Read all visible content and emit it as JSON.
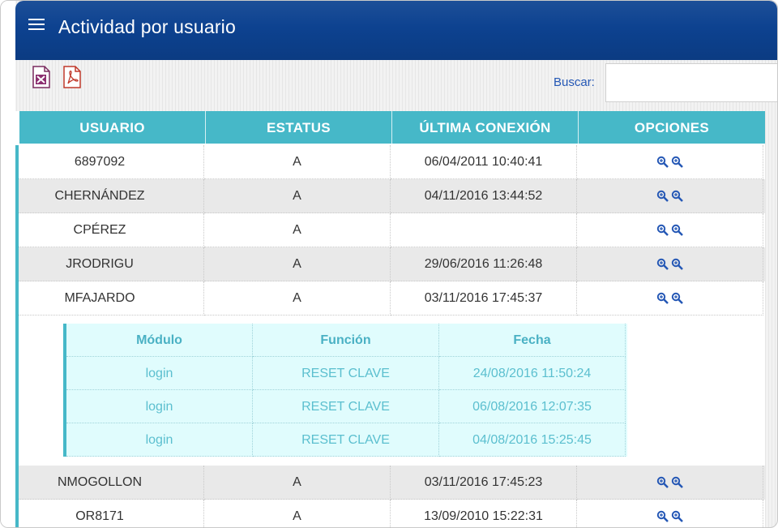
{
  "header": {
    "title": "Actividad por usuario"
  },
  "toolbar": {
    "export_excel_icon": "excel-icon",
    "export_pdf_icon": "pdf-icon",
    "search_label": "Buscar:",
    "search_value": ""
  },
  "colors": {
    "header": "#0d4290",
    "table_header": "#46b8c8",
    "detail_bg": "#e0fcfd",
    "detail_text": "#5bbfcf",
    "icon_blue": "#2457b5"
  },
  "table": {
    "columns": [
      "USUARIO",
      "ESTATUS",
      "ÚLTIMA CONEXIÓN",
      "OPCIONES"
    ],
    "rows": [
      {
        "usuario": "6897092",
        "estatus": "A",
        "conexion": "06/04/2011 10:40:41"
      },
      {
        "usuario": "CHERNÁNDEZ",
        "estatus": "A",
        "conexion": "04/11/2016 13:44:52"
      },
      {
        "usuario": "CPÉREZ",
        "estatus": "A",
        "conexion": ""
      },
      {
        "usuario": "JRODRIGU",
        "estatus": "A",
        "conexion": "29/06/2016 11:26:48"
      },
      {
        "usuario": "MFAJARDO",
        "estatus": "A",
        "conexion": "03/11/2016 17:45:37"
      },
      {
        "usuario": "NMOGOLLON",
        "estatus": "A",
        "conexion": "03/11/2016 17:45:23"
      },
      {
        "usuario": "OR8171",
        "estatus": "A",
        "conexion": "13/09/2010 15:22:31"
      }
    ]
  },
  "detail": {
    "columns": [
      "Módulo",
      "Función",
      "Fecha"
    ],
    "rows": [
      {
        "modulo": "login",
        "funcion": "RESET CLAVE",
        "fecha": "24/08/2016 11:50:24"
      },
      {
        "modulo": "login",
        "funcion": "RESET CLAVE",
        "fecha": "06/08/2016 12:07:35"
      },
      {
        "modulo": "login",
        "funcion": "RESET CLAVE",
        "fecha": "04/08/2016 15:25:45"
      }
    ]
  }
}
